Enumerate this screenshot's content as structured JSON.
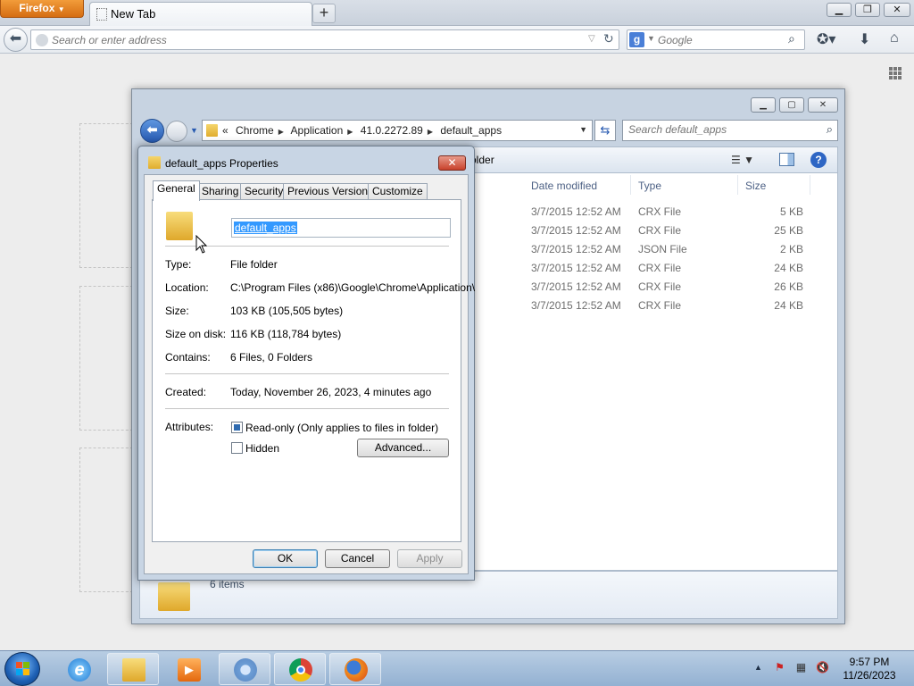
{
  "firefox": {
    "menu_label": "Firefox",
    "tab_label": "New Tab",
    "new_tab_symbol": "+",
    "address_placeholder": "Search or enter address",
    "search_engine_letter": "g",
    "search_placeholder": "Google"
  },
  "explorer": {
    "breadcrumb": {
      "overflow": "«",
      "crumbs": [
        "Chrome",
        "Application",
        "41.0.2272.89",
        "default_apps"
      ]
    },
    "search_placeholder": "Search default_apps",
    "toolbar_fragment": "older",
    "columns": [
      "Date modified",
      "Type",
      "Size"
    ],
    "rows": [
      {
        "date": "3/7/2015 12:52 AM",
        "type": "CRX File",
        "size": "5 KB"
      },
      {
        "date": "3/7/2015 12:52 AM",
        "type": "CRX File",
        "size": "25 KB"
      },
      {
        "date": "3/7/2015 12:52 AM",
        "type": "JSON File",
        "size": "2 KB"
      },
      {
        "date": "3/7/2015 12:52 AM",
        "type": "CRX File",
        "size": "24 KB"
      },
      {
        "date": "3/7/2015 12:52 AM",
        "type": "CRX File",
        "size": "26 KB"
      },
      {
        "date": "3/7/2015 12:52 AM",
        "type": "CRX File",
        "size": "24 KB"
      }
    ],
    "status_items": "6 items"
  },
  "properties": {
    "title": "default_apps Properties",
    "tabs": [
      "General",
      "Sharing",
      "Security",
      "Previous Versions",
      "Customize"
    ],
    "name_value": "default_apps",
    "type_label": "Type:",
    "type_value": "File folder",
    "location_label": "Location:",
    "location_value": "C:\\Program Files (x86)\\Google\\Chrome\\Application\\",
    "size_label": "Size:",
    "size_value": "103 KB (105,505 bytes)",
    "size_on_disk_label": "Size on disk:",
    "size_on_disk_value": "116 KB (118,784 bytes)",
    "contains_label": "Contains:",
    "contains_value": "6 Files, 0 Folders",
    "created_label": "Created:",
    "created_value": "Today, November 26, 2023, 4 minutes ago",
    "attributes_label": "Attributes:",
    "readonly_label": "Read-only (Only applies to files in folder)",
    "hidden_label": "Hidden",
    "advanced_label": "Advanced...",
    "ok_label": "OK",
    "cancel_label": "Cancel",
    "apply_label": "Apply",
    "readonly_state": "indeterminate",
    "hidden_state": "unchecked"
  },
  "taskbar": {
    "apps": [
      "internet-explorer",
      "windows-explorer",
      "media-player",
      "chromium",
      "chrome",
      "firefox"
    ],
    "clock_time": "9:57 PM",
    "clock_date": "11/26/2023"
  },
  "colors": {
    "firefox_orange": "#e57f22",
    "selection_blue": "#3399ff",
    "window_frame": "#c7d3e1"
  }
}
